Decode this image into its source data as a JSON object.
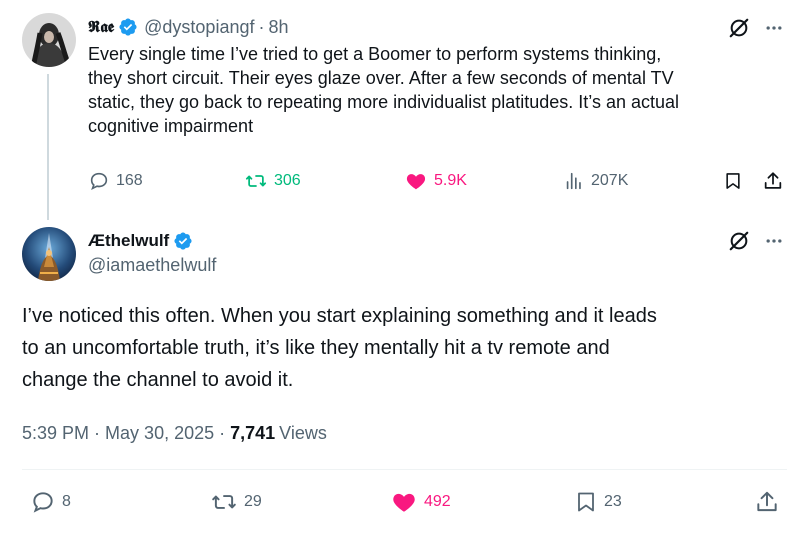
{
  "quoted_tweet": {
    "display_name": "𝕽𝖆𝖊",
    "handle": "@dystopiangf",
    "separator": "·",
    "time": "8h",
    "text_lines": [
      "Every single time I’ve tried to get a Boomer to perform systems thinking,",
      "they short circuit. Their eyes glaze over. After a few seconds of mental TV",
      "static, they go back to repeating more individualist platitudes. It’s an actual",
      "cognitive impairment"
    ],
    "replies": "168",
    "reposts": "306",
    "likes": "5.9K",
    "views": "207K"
  },
  "main_tweet": {
    "display_name": "Æthelwulf",
    "handle": "@iamaethelwulf",
    "text_lines": [
      "I’ve noticed this often. When you start explaining something and it leads",
      "to an uncomfortable truth, it’s like they mentally hit a tv remote and",
      "change the channel to avoid it."
    ],
    "time": "5:39 PM",
    "date": "May 30, 2025",
    "separator": "·",
    "view_count": "7,741",
    "view_label": "Views",
    "replies": "8",
    "reposts": "29",
    "likes": "492",
    "bookmarks": "23"
  },
  "icons": {
    "grok": "grok-slash-icon",
    "more": "more-dots-icon",
    "reply": "reply-bubble-icon",
    "repost": "repost-arrows-icon",
    "like": "heart-filled-icon",
    "views": "bar-chart-icon",
    "bookmark": "bookmark-icon",
    "share": "share-upload-icon",
    "verified": "verified-badge-icon"
  },
  "colors": {
    "text": "#0f1419",
    "muted": "#536471",
    "verified": "#1d9bf0",
    "repost_active": "#00ba7c",
    "like_active": "#f91880",
    "divider": "#eff3f4"
  }
}
